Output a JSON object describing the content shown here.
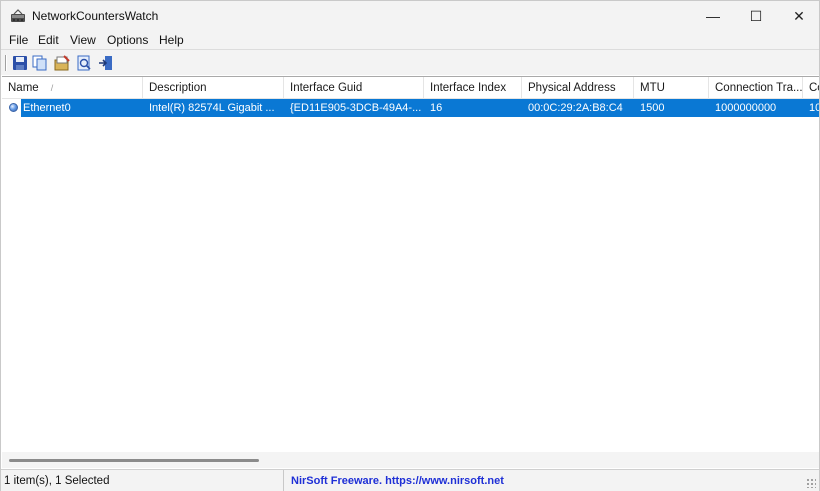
{
  "window": {
    "title": "NetworkCountersWatch",
    "controls": {
      "minimize": "—",
      "maximize": "☐",
      "close": "✕"
    }
  },
  "menu": [
    "File",
    "Edit",
    "View",
    "Options",
    "Help"
  ],
  "toolbar": {
    "buttons": [
      "save-icon",
      "copy-icon",
      "properties-icon",
      "html-report-icon",
      "exit-icon"
    ]
  },
  "table": {
    "columns": [
      "Name",
      "Description",
      "Interface Guid",
      "Interface Index",
      "Physical Address",
      "MTU",
      "Connection Tra...",
      "Co"
    ],
    "sort_indicator": "/",
    "rows": [
      {
        "selected": true,
        "cells": [
          "Ethernet0",
          "Intel(R) 82574L Gigabit ...",
          "{ED11E905-3DCB-49A4-...",
          "16",
          "00:0C:29:2A:B8:C4",
          "1500",
          "1000000000",
          "10"
        ]
      }
    ]
  },
  "status": {
    "items": "1 item(s), 1 Selected",
    "credit": "NirSoft Freeware. https://www.nirsoft.net"
  },
  "colors": {
    "selection": "#0a78d4",
    "credit_link": "#1e2fd6",
    "chrome": "#f3f3f3"
  }
}
